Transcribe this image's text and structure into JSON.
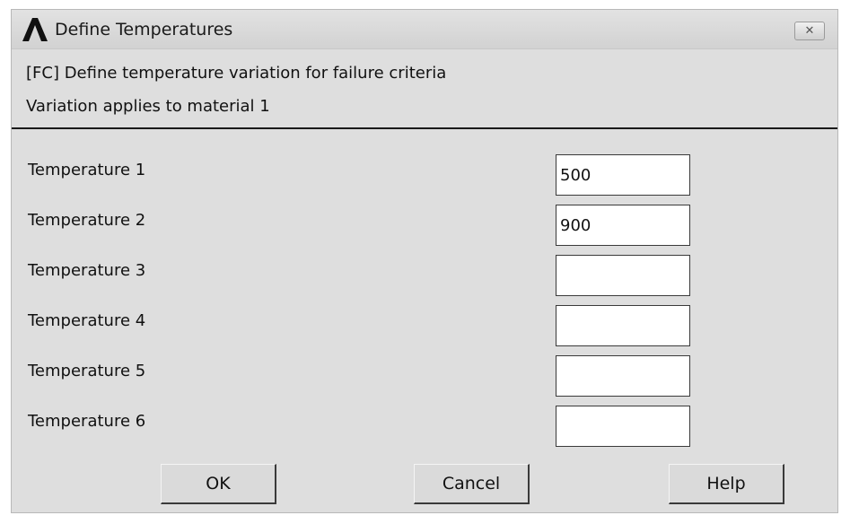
{
  "window": {
    "title": "Define Temperatures",
    "app_icon": "ansys-logo-icon",
    "close_icon": "close-icon",
    "close_glyph": "✕"
  },
  "header": {
    "line1": "[FC] Define temperature variation for failure criteria",
    "line2": "Variation applies to material 1"
  },
  "fields": [
    {
      "label": "Temperature 1",
      "value": "500"
    },
    {
      "label": "Temperature 2",
      "value": "900"
    },
    {
      "label": "Temperature 3",
      "value": ""
    },
    {
      "label": "Temperature 4",
      "value": ""
    },
    {
      "label": "Temperature 5",
      "value": ""
    },
    {
      "label": "Temperature 6",
      "value": ""
    }
  ],
  "buttons": {
    "ok": "OK",
    "cancel": "Cancel",
    "help": "Help"
  }
}
